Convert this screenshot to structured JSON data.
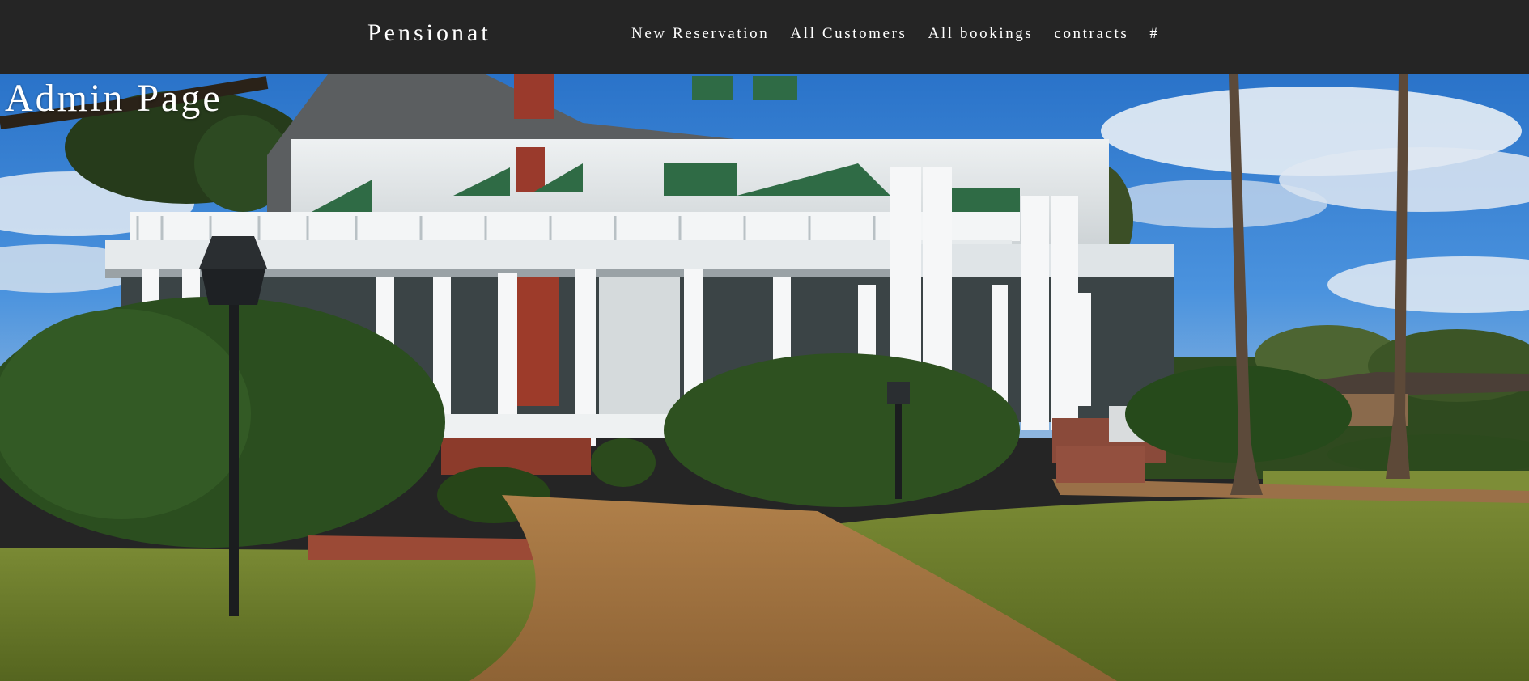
{
  "navbar": {
    "brand": "Pensionat",
    "links": [
      {
        "label": "New Reservation"
      },
      {
        "label": "All Customers"
      },
      {
        "label": "All bookings"
      },
      {
        "label": "contracts"
      },
      {
        "label": "#"
      }
    ]
  },
  "page": {
    "title": "Admin Page"
  },
  "hero": {
    "image_description_icon": "hero-photo"
  },
  "colors": {
    "navbar_bg": "#252525",
    "text": "#ffffff",
    "sky": "#2f7fd0",
    "lawn": "#6d7a2c",
    "path": "#a77744"
  }
}
